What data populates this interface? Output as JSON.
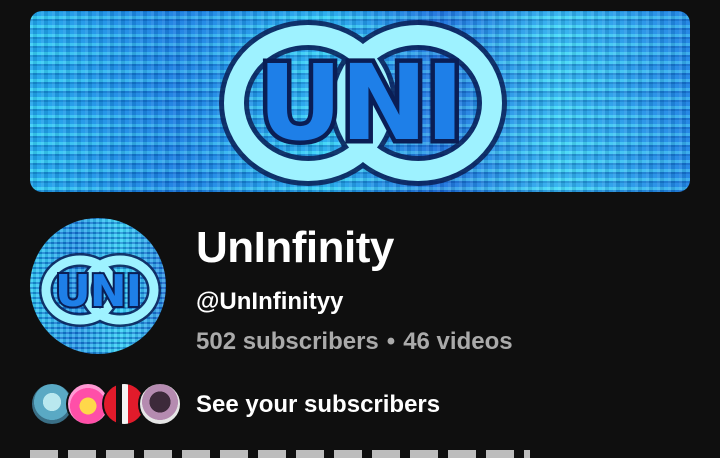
{
  "banner": {
    "logo_text": "UNI"
  },
  "avatar": {
    "logo_text": "UNI"
  },
  "channel": {
    "name": "UnInfinity",
    "handle": "@UnInfinityy",
    "subscribers": "502 subscribers",
    "separator": "•",
    "videos": "46 videos"
  },
  "subscribers_row": {
    "label": "See your subscribers"
  },
  "colors": {
    "background": "#0f0f0f",
    "text": "#ffffff",
    "secondary_text": "#aaaaaa",
    "banner_blue": "#1a8fe6",
    "banner_cyan": "#2ad0f6"
  }
}
